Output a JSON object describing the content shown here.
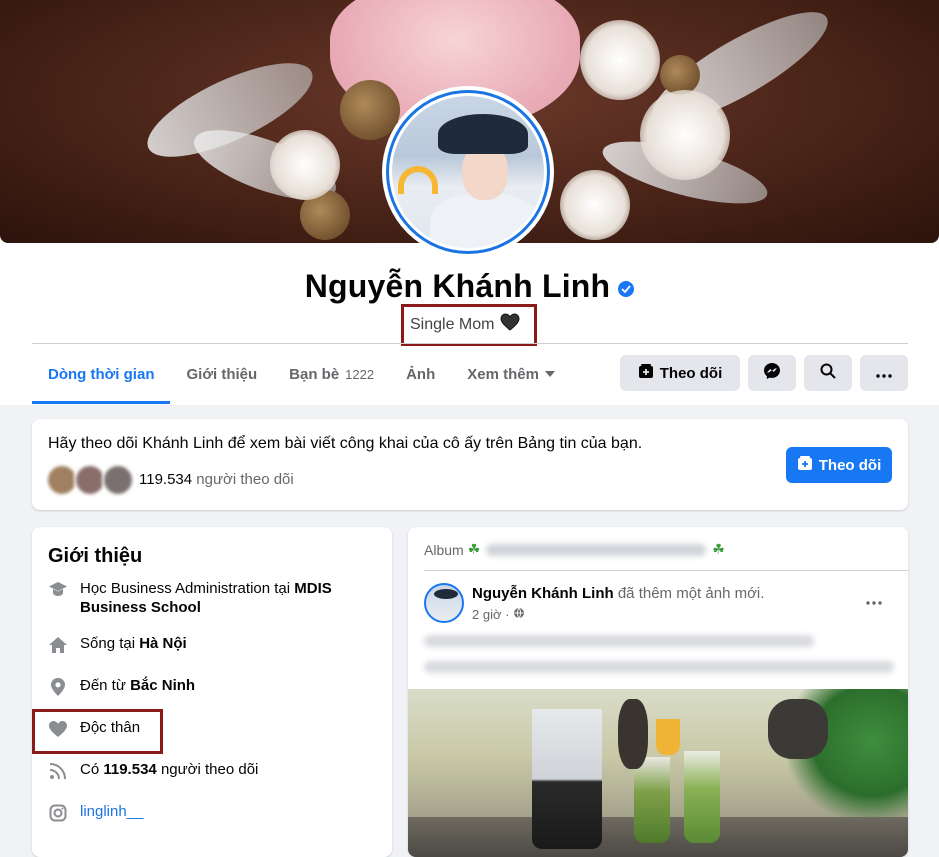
{
  "profile": {
    "name": "Nguyễn Khánh Linh",
    "bio": "Single Mom",
    "verified": true
  },
  "tabs": [
    {
      "label": "Dòng thời gian",
      "active": true
    },
    {
      "label": "Giới thiệu"
    },
    {
      "label": "Bạn bè",
      "count": "1222"
    },
    {
      "label": "Ảnh"
    },
    {
      "label": "Xem thêm"
    }
  ],
  "actions": {
    "follow_label": "Theo dõi",
    "messenger_icon": "messenger-icon",
    "search_icon": "search-icon",
    "more_icon": "more-icon"
  },
  "follow_prompt": {
    "text": "Hãy theo dõi Khánh Linh để xem bài viết công khai của cô ấy trên Bảng tin của bạn.",
    "followers_value": "119.534",
    "followers_suffix": "người theo dõi",
    "button_label": "Theo dõi"
  },
  "intro": {
    "title": "Giới thiệu",
    "study_prefix": "Học Business Administration tại",
    "study_place": "MDIS Business School",
    "lives_prefix": "Sống tại",
    "lives_place": "Hà Nội",
    "from_prefix": "Đến từ",
    "from_place": "Bắc Ninh",
    "relationship": "Độc thân",
    "followers_prefix": "Có",
    "followers_value": "119.534",
    "followers_suffix": "người theo dõi",
    "instagram": "linglinh__"
  },
  "post": {
    "album_label": "Album",
    "author": "Nguyễn Khánh Linh",
    "action": "đã thêm một ảnh mới.",
    "time": "2 giờ ·"
  },
  "colors": {
    "accent": "#1877f2",
    "highlight_box": "#8b1a1a",
    "page_bg": "#f0f2f5"
  }
}
